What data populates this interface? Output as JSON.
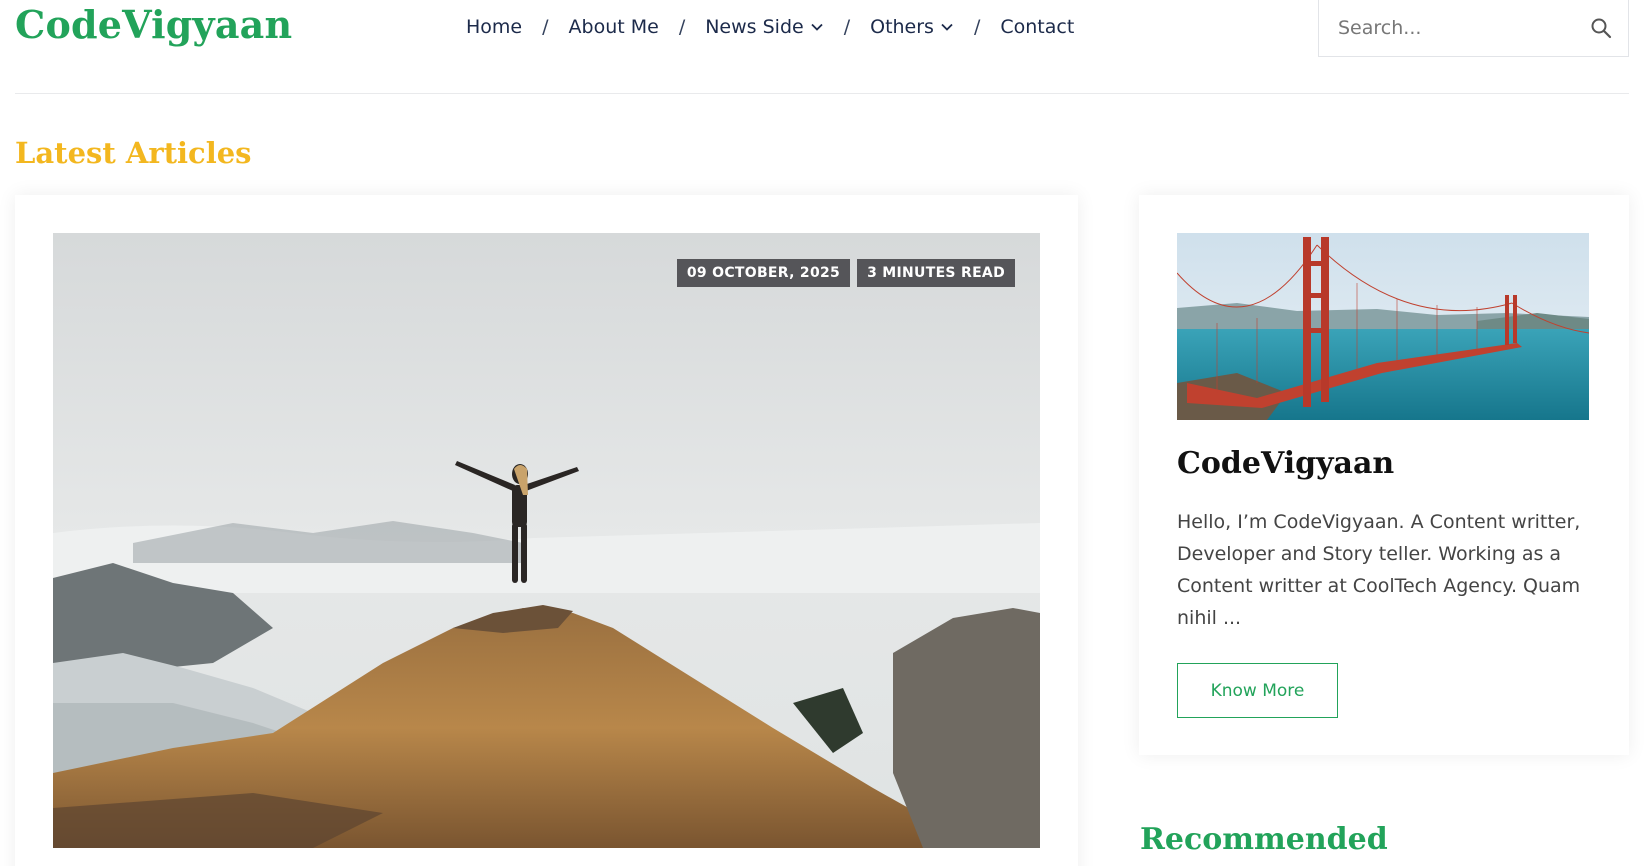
{
  "brand": {
    "name": "CodeVigyaan",
    "accent_color": "#22a35a",
    "highlight_color": "#f3b71f"
  },
  "nav": {
    "items": [
      {
        "label": "Home",
        "has_dropdown": false
      },
      {
        "label": "About Me",
        "has_dropdown": false
      },
      {
        "label": "News Side",
        "has_dropdown": true
      },
      {
        "label": "Others",
        "has_dropdown": true
      },
      {
        "label": "Contact",
        "has_dropdown": false
      }
    ],
    "separator": "/"
  },
  "search": {
    "placeholder": "Search...",
    "icon": "search-icon"
  },
  "latest": {
    "title": "Latest Articles",
    "featured": {
      "date": "09 OCTOBER, 2025",
      "read_time": "3 MINUTES READ",
      "image": "woman-on-mountain-peak"
    }
  },
  "sidebar": {
    "image": "golden-gate-bridge",
    "title": "CodeVigyaan",
    "text": "Hello, I’m CodeVigyaan. A Content writter, Developer and Story teller. Working as a Content writter at CoolTech Agency. Quam nihil ...",
    "button_label": "Know More"
  },
  "recommended": {
    "title": "Recommended"
  }
}
